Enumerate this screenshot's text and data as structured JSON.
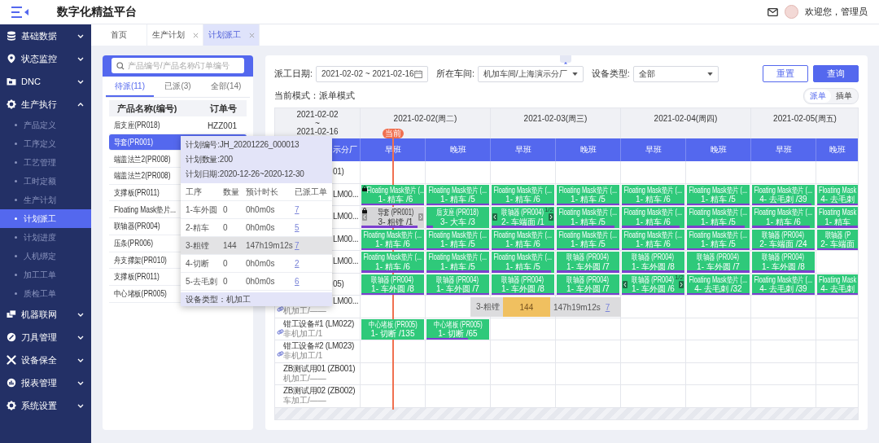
{
  "header": {
    "title": "数字化精益平台",
    "greeting": "欢迎您，管理员"
  },
  "sidebar": {
    "items": [
      {
        "label": "基础数据",
        "expanded": false
      },
      {
        "label": "状态监控",
        "expanded": false
      },
      {
        "label": "DNC",
        "expanded": false
      },
      {
        "label": "生产执行",
        "expanded": true,
        "children": [
          {
            "label": "产品定义",
            "selected": false
          },
          {
            "label": "工序定义",
            "selected": false
          },
          {
            "label": "工艺管理",
            "selected": false
          },
          {
            "label": "工时定额",
            "selected": false
          },
          {
            "label": "生产计划",
            "selected": false
          },
          {
            "label": "计划派工",
            "selected": true
          },
          {
            "label": "计划进度",
            "selected": false
          },
          {
            "label": "人机绑定",
            "selected": false
          },
          {
            "label": "加工工单",
            "selected": false
          },
          {
            "label": "质检工单",
            "selected": false
          }
        ]
      },
      {
        "label": "机器联网",
        "expanded": false
      },
      {
        "label": "刀具管理",
        "expanded": false
      },
      {
        "label": "设备保全",
        "expanded": false
      },
      {
        "label": "报表管理",
        "expanded": false
      },
      {
        "label": "系统设置",
        "expanded": false
      }
    ]
  },
  "tabs": [
    {
      "label": "首页",
      "closable": false,
      "selected": false
    },
    {
      "label": "生产计划",
      "closable": true,
      "selected": false
    },
    {
      "label": "计划派工",
      "closable": true,
      "selected": true
    }
  ],
  "product_panel": {
    "search": {
      "placeholder": "产品编号/产品名称/订单编号"
    },
    "tabs": [
      {
        "label": "待派(11)",
        "selected": true
      },
      {
        "label": "已派(3)",
        "selected": false
      },
      {
        "label": "全部(14)",
        "selected": false
      }
    ],
    "columns": [
      "产品名称(编号)",
      "订单号"
    ],
    "rows": [
      {
        "name": "后支座(PR018)",
        "order": "HZZ001",
        "selected": false
      },
      {
        "name": "导套(PR001)",
        "selected": true
      },
      {
        "name": "端盖法兰2(PR008)",
        "selected": false
      },
      {
        "name": "端盖法兰2(PR008)",
        "selected": false
      },
      {
        "name": "支撑板(PR011)",
        "selected": false
      },
      {
        "name": "Floating Mask垫片...",
        "selected": false
      },
      {
        "name": "联轴器(PR004)",
        "selected": false
      },
      {
        "name": "压条(PR006)",
        "selected": false
      },
      {
        "name": "舟支撑架(PR010)",
        "selected": false
      },
      {
        "name": "支撑板(PR011)",
        "selected": false
      },
      {
        "name": "中心堵板(PR005)",
        "selected": false
      }
    ]
  },
  "plan_popup": {
    "plan_no": "计划编号:JH_20201226_000013",
    "plan_qty": "计划数量:200",
    "plan_date": "计划日期:2020-12-26~2020-12-30",
    "columns": [
      "工序",
      "数量",
      "预计时长",
      "已派工单"
    ],
    "rows": [
      {
        "step": "1-车外圆",
        "qty": "0",
        "duration": "0h0m0s",
        "orders": "7",
        "selected": false
      },
      {
        "step": "2-精车",
        "qty": "0",
        "duration": "0h0m0s",
        "orders": "5",
        "selected": false
      },
      {
        "step": "3-粗镗",
        "qty": "144",
        "duration": "147h19m12s",
        "orders": "7",
        "selected": true
      },
      {
        "step": "4-切断",
        "qty": "0",
        "duration": "0h0m0s",
        "orders": "2",
        "selected": false
      },
      {
        "step": "5-去毛刺",
        "qty": "0",
        "duration": "0h0m0s",
        "orders": "6",
        "selected": false
      }
    ],
    "footer": "设备类型：机加工"
  },
  "filters": {
    "date_label": "派工日期:",
    "date_value": "2021-02-02 ~ 2021-02-16",
    "workshop_label": "所在车间:",
    "workshop_value": "机加车间/上海演示分厂",
    "type_label": "设备类型:",
    "type_value": "全部",
    "buttons": [
      {
        "label": "重置",
        "kind": "secondary"
      },
      {
        "label": "查询",
        "kind": "primary"
      }
    ]
  },
  "mode": {
    "text": "当前模式：派单模式",
    "options": [
      {
        "label": "派单",
        "selected": true
      },
      {
        "label": "插单",
        "selected": false
      }
    ]
  },
  "gantt": {
    "range": [
      "2021-02-02",
      "~",
      "2021-02-16"
    ],
    "days": [
      "2021-02-02(周二)",
      "2021-02-03(周三)",
      "2021-02-04(周四)",
      "2021-02-05(周五)"
    ],
    "corner": "示分厂",
    "shifts": [
      "早班",
      "晚班",
      "早班",
      "晚班",
      "早班",
      "晚班",
      "早班",
      "晚班"
    ],
    "now_label": "当前",
    "machines": [
      {
        "kind": "covered",
        "name": "01)",
        "cells": [
          null,
          null,
          null,
          null,
          null,
          null,
          null,
          null
        ]
      },
      {
        "kind": "covered",
        "name": "LM00...",
        "cells": [
          {
            "kind": "task",
            "name": "Floating Mask垫片 (...",
            "step": "1- 精车 /6",
            "level": 1,
            "locked": true,
            "paged": false
          },
          {
            "kind": "task",
            "name": "Floating Mask垫片 (...",
            "step": "1- 精车 /5",
            "level": 1,
            "locked": false,
            "paged": false
          },
          {
            "kind": "task",
            "name": "Floating Mask垫片 (...",
            "step": "1- 精车 /6",
            "level": 1,
            "locked": false,
            "paged": false
          },
          {
            "kind": "task",
            "name": "Floating Mask垫片 (...",
            "step": "1- 精车 /5",
            "level": 1,
            "locked": false,
            "paged": false
          },
          {
            "kind": "task",
            "name": "Floating Mask垫片 (...",
            "step": "1- 精车 /6",
            "level": 1,
            "locked": false,
            "paged": false
          },
          {
            "kind": "task",
            "name": "Floating Mask垫片 (...",
            "step": "1- 精车 /5",
            "level": 1,
            "locked": false,
            "paged": false
          },
          {
            "kind": "task",
            "name": "Floating Mask垫片 (...",
            "step": "4- 去毛刺 /39",
            "level": 0.95,
            "locked": false,
            "paged": false
          },
          {
            "kind": "task",
            "name": "Floating Mask",
            "step": "4- 去毛刺",
            "level": 1,
            "locked": false,
            "paged": false
          }
        ]
      },
      {
        "kind": "covered",
        "name": "LM00...",
        "cells": [
          {
            "kind": "pending",
            "name": "导套 (PR001)",
            "step": "3- 粗镗 /1",
            "level": 0.9,
            "locked": true,
            "paged": true
          },
          {
            "kind": "task",
            "name": "后支座 (PR018)",
            "step": "3- 大车 /3",
            "level": 0.1,
            "locked": false,
            "paged": false
          },
          {
            "kind": "task",
            "name": "联轴器 (PR004)",
            "step": "2- 车端面 /1",
            "level": 1,
            "locked": false,
            "paged": true,
            "page": "1/2"
          },
          {
            "kind": "task",
            "name": "Floating Mask垫片 (...",
            "step": "1- 精车 /5",
            "level": 0.92,
            "locked": false,
            "paged": false
          },
          {
            "kind": "task",
            "name": "Floating Mask垫片 (...",
            "step": "1- 精车 /6",
            "level": 0.92,
            "locked": false,
            "paged": false
          },
          {
            "kind": "task",
            "name": "Floating Mask垫片 (...",
            "step": "1- 精车 /5",
            "level": 0.92,
            "locked": false,
            "paged": false
          },
          {
            "kind": "task",
            "name": "Floating Mask垫片 (...",
            "step": "1- 精车 /6",
            "level": 0.92,
            "locked": false,
            "paged": false
          },
          {
            "kind": "task",
            "name": "Floating Mask",
            "step": "1- 精车",
            "level": 1,
            "locked": false,
            "paged": false
          }
        ]
      },
      {
        "kind": "covered",
        "name": "LM00...",
        "cells": [
          {
            "kind": "task",
            "name": "Floating Mask垫片 (...",
            "step": "1- 精车 /6",
            "level": 1,
            "locked": false,
            "paged": false
          },
          {
            "kind": "task",
            "name": "Floating Mask垫片 (...",
            "step": "1- 精车 /5",
            "level": 1,
            "locked": false,
            "paged": false
          },
          {
            "kind": "task",
            "name": "Floating Mask垫片 (...",
            "step": "1- 精车 /6",
            "level": 1,
            "locked": false,
            "paged": false
          },
          {
            "kind": "task",
            "name": "Floating Mask垫片 (...",
            "step": "1- 精车 /5",
            "level": 1,
            "locked": false,
            "paged": false
          },
          {
            "kind": "task",
            "name": "Floating Mask垫片 (...",
            "step": "1- 精车 /6",
            "level": 1,
            "locked": false,
            "paged": false
          },
          {
            "kind": "task",
            "name": "Floating Mask垫片 (...",
            "step": "1- 精车 /5",
            "level": 1,
            "locked": false,
            "paged": false
          },
          {
            "kind": "task",
            "name": "联轴器 (PR004)",
            "step": "2- 车端面 /24",
            "level": 1,
            "locked": false,
            "paged": false
          },
          {
            "kind": "task",
            "name": "联轴器 (P",
            "step": "2- 车端面",
            "level": 1,
            "locked": false,
            "paged": false
          }
        ]
      },
      {
        "kind": "covered",
        "name": "LM00...",
        "cells": [
          {
            "kind": "task",
            "name": "Floating Mask垫片 (...",
            "step": "1- 精车 /6",
            "level": 1,
            "locked": false,
            "paged": false
          },
          {
            "kind": "task",
            "name": "Floating Mask垫片 (...",
            "step": "1- 精车 /5",
            "level": 1,
            "locked": false,
            "paged": false
          },
          {
            "kind": "task",
            "name": "Floating Mask垫片 (...",
            "step": "1- 精车 /5",
            "level": 0.95,
            "locked": false,
            "paged": false
          },
          {
            "kind": "task",
            "name": "联轴器 (PR004)",
            "step": "1- 车外圆 /7",
            "level": 1,
            "locked": false,
            "paged": false
          },
          {
            "kind": "task",
            "name": "联轴器 (PR004)",
            "step": "1- 车外圆 /8",
            "level": 1,
            "locked": false,
            "paged": false
          },
          {
            "kind": "task",
            "name": "联轴器 (PR004)",
            "step": "1- 车外圆 /7",
            "level": 1,
            "locked": false,
            "paged": false
          },
          {
            "kind": "task",
            "name": "联轴器 (PR004)",
            "step": "1- 车外圆 /8",
            "level": 1,
            "locked": false,
            "paged": false
          },
          null
        ]
      },
      {
        "kind": "covered",
        "name": "05)",
        "cells": [
          {
            "kind": "task",
            "name": "联轴器 (PR004)",
            "step": "1- 车外圆 /8",
            "level": 1,
            "locked": false,
            "paged": false
          },
          {
            "kind": "task",
            "name": "联轴器 (PR004)",
            "step": "1- 车外圆 /7",
            "level": 1,
            "locked": false,
            "paged": false
          },
          {
            "kind": "task",
            "name": "联轴器 (PR004)",
            "step": "1- 车外圆 /8",
            "level": 1,
            "locked": false,
            "paged": false
          },
          {
            "kind": "task",
            "name": "联轴器 (PR004)",
            "step": "1- 车外圆 /7",
            "level": 1,
            "locked": false,
            "paged": false
          },
          {
            "kind": "task",
            "name": "联轴器 (PR004)",
            "step": "1- 车外圆 /6",
            "level": 1,
            "locked": false,
            "paged": true,
            "page": "1/2"
          },
          {
            "kind": "task",
            "name": "Floating Mask垫片 (...",
            "step": "4- 去毛刺 /32",
            "level": 1,
            "locked": false,
            "paged": false
          },
          {
            "kind": "task",
            "name": "Floating Mask垫片 (...",
            "step": "4- 去毛刺 /39",
            "level": 1,
            "locked": false,
            "paged": false
          },
          {
            "kind": "task",
            "name": "Floating Mask",
            "step": "4- 去毛刺",
            "level": 1,
            "locked": false,
            "paged": false
          }
        ]
      },
      {
        "kind": "covered",
        "name": "LM00...",
        "sub": "机加工/——",
        "linked": true,
        "cells": [
          null,
          null,
          null,
          null,
          null,
          null,
          null,
          null
        ]
      },
      {
        "kind": "machine",
        "name": "钳工设备#1 (LM022)",
        "sub": "非机加工/1",
        "linked": true,
        "cells": [
          {
            "kind": "task",
            "name": "中心堵板 (PR005)",
            "step": "1- 切断 /135",
            "locked": false,
            "paged": false
          },
          {
            "kind": "task",
            "name": "中心堵板 (PR005)",
            "step": "1- 切断 /65",
            "level": 0.66,
            "locked": false,
            "paged": false
          },
          null,
          null,
          null,
          null,
          null,
          null
        ]
      },
      {
        "kind": "machine",
        "name": "钳工设备#2 (LM023)",
        "sub": "非机加工/1",
        "linked": true,
        "cells": [
          null,
          null,
          null,
          null,
          null,
          null,
          null,
          null
        ]
      },
      {
        "kind": "machine",
        "name": "ZB测试用01 (ZB001)",
        "sub": "机加工/——",
        "linked": false,
        "cells": [
          null,
          null,
          null,
          null,
          null,
          null,
          null,
          null
        ]
      },
      {
        "kind": "machine",
        "name": "ZB测试用02 (ZB002)",
        "sub": "车加工/——",
        "linked": false,
        "cells": [
          null,
          null,
          null,
          null,
          null,
          null,
          null,
          null
        ]
      }
    ],
    "drag_preview": {
      "step": "3-粗镗",
      "qty": "144",
      "duration": "147h19m12s",
      "orders": "7"
    }
  }
}
